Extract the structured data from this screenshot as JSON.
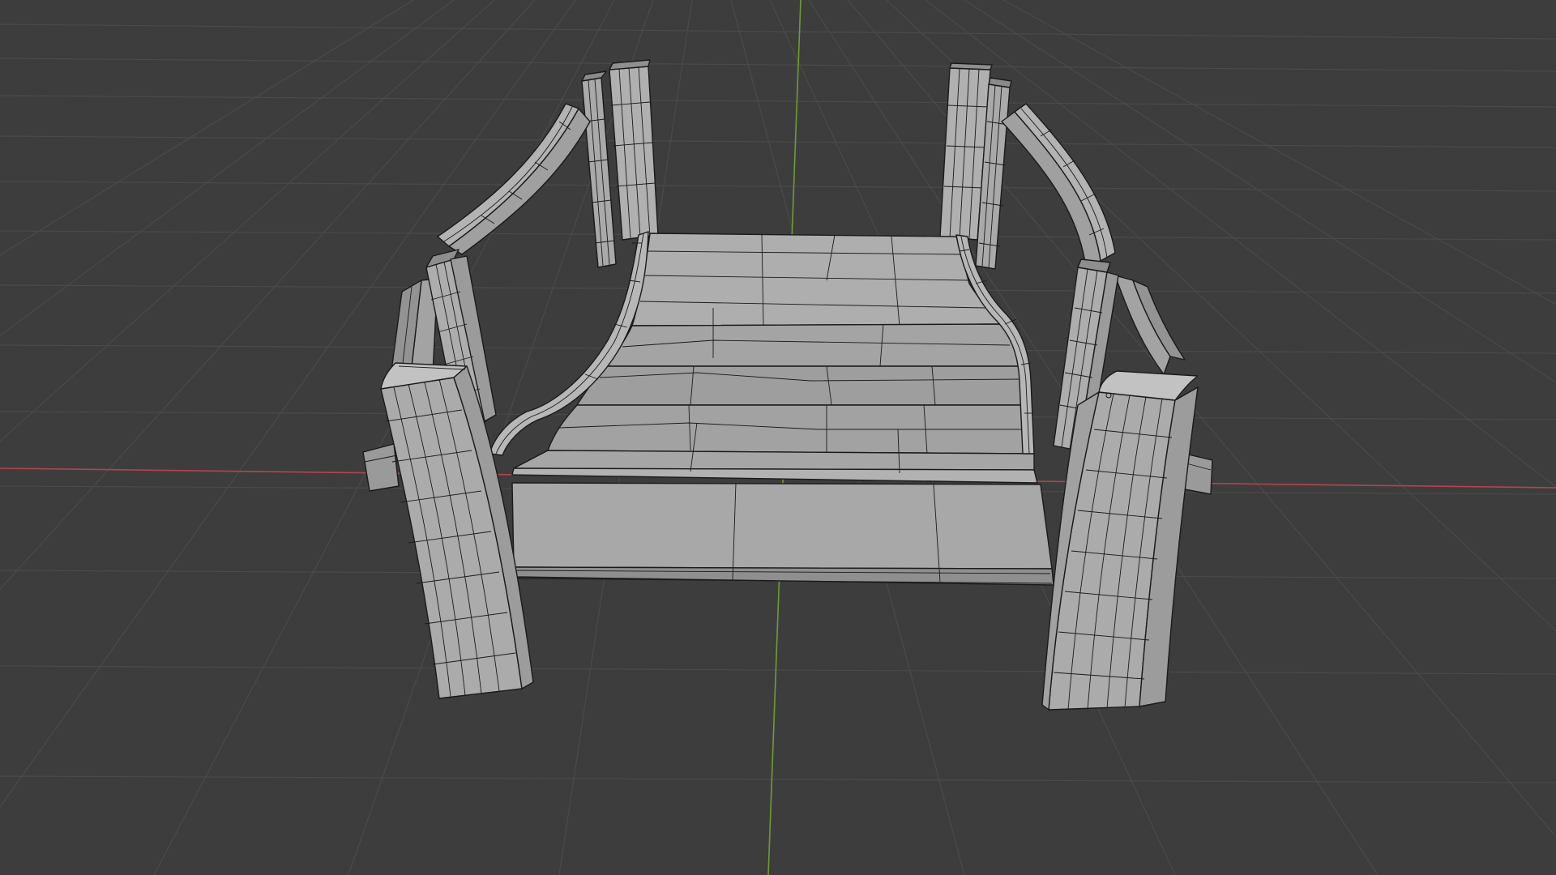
{
  "viewport": {
    "background_color": "#3d3d3d",
    "grid_color": "#4a4a4a",
    "axis_x_color": "#b4434f",
    "axis_y_color": "#6f9a3a",
    "mesh_light_color": "#a9a9a9",
    "mesh_mid_color": "#959595",
    "mesh_dark_color": "#7d7d7d",
    "wireframe_color": "#1a1a1a"
  }
}
